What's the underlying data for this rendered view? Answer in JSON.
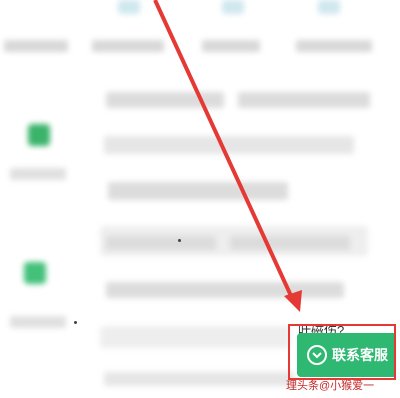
{
  "contact_button": {
    "label": "联系客服",
    "icon": "chat-bubble-icon"
  },
  "overlay_text": "叶磁伤?",
  "watermark": "理头条@小猴爱一",
  "partial_question": "?",
  "colors": {
    "button_green": "#2eb872",
    "annotation_red": "#e53935",
    "blurred_gray": "#dcdcdc"
  }
}
